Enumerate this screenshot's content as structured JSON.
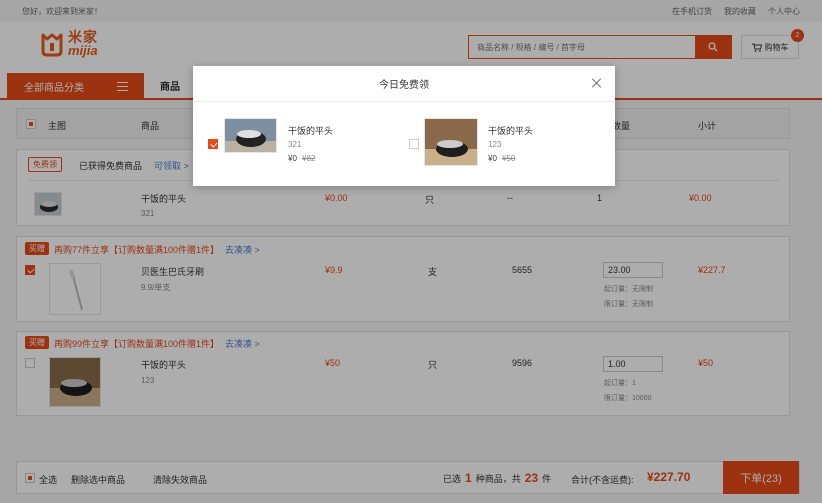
{
  "topbar": {
    "welcome": "您好，欢迎来到米家！",
    "links": [
      "在手机订货",
      "我的收藏",
      "个人中心"
    ]
  },
  "header": {
    "logo_cn": "米家",
    "logo_en": "mijia",
    "search_placeholder": "商品名称 / 规格 / 编号 / 首字母",
    "cart_label": "购物车",
    "cart_count": "2"
  },
  "nav": {
    "all_categories": "全部商品分类",
    "item": "商品"
  },
  "table_header": {
    "select_all": "全选",
    "columns": [
      "主图",
      "商品",
      "单价",
      "单位",
      "库存",
      "数量",
      "小计"
    ]
  },
  "free_section": {
    "tag": "免费领",
    "text": "已获得免费商品",
    "link": "可领取 >",
    "item": {
      "name": "干饭的平头",
      "spec": "321",
      "price": "¥0.00",
      "unit": "只",
      "stock": "--",
      "qty": "1",
      "subtotal": "¥0.00"
    }
  },
  "group1": {
    "tag": "买赠",
    "promo": "再购77件立享【订购数量满100件赠1件】",
    "link": "去凑凑 >",
    "item": {
      "name": "贝医生巴氏牙刷",
      "spec": "9.9/单支",
      "price": "¥9.9",
      "unit": "支",
      "stock": "5655",
      "qty": "23.00",
      "min_label": "起订量：无限制",
      "max_label": "限订量：无限制",
      "subtotal": "¥227.7"
    }
  },
  "group2": {
    "tag": "买赠",
    "promo": "再购99件立享【订购数量满100件赠1件】",
    "link": "去凑凑 >",
    "item": {
      "name": "干饭的平头",
      "spec": "123",
      "price": "¥50",
      "unit": "只",
      "stock": "9596",
      "qty": "1.00",
      "min_label": "起订量：1",
      "max_label": "限订量：10000",
      "subtotal": "¥50"
    }
  },
  "footer": {
    "select_all": "全选",
    "delete_selected": "删除选中商品",
    "clear_invalid": "清除失效商品",
    "selected_prefix": "已选",
    "selected_count": "1",
    "selected_mid": "种商品，共",
    "total_qty": "23",
    "selected_suffix": "件",
    "total_label": "合计(不含运费):",
    "total_amount": "¥227.70",
    "order_button": "下单(23)"
  },
  "modal": {
    "title": "今日免费领",
    "items": [
      {
        "name": "干饭的平头",
        "spec": "321",
        "price": "¥0",
        "original": "¥82",
        "checked": true
      },
      {
        "name": "干饭的平头",
        "spec": "123",
        "price": "¥0",
        "original": "¥50",
        "checked": false
      }
    ]
  },
  "colors": {
    "accent": "#e64a19",
    "link": "#4a7fd6"
  }
}
